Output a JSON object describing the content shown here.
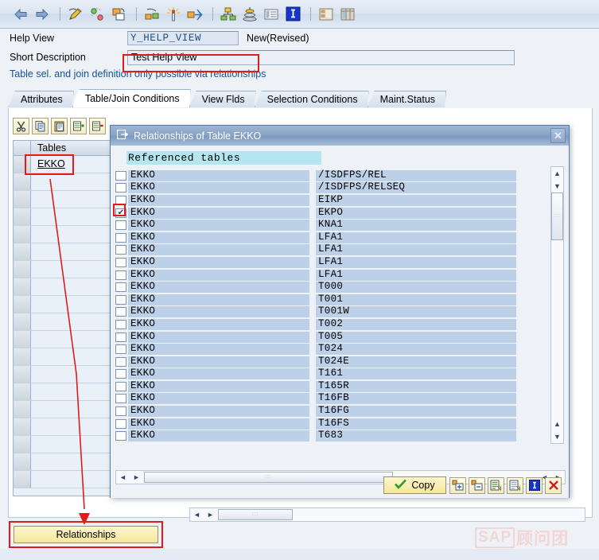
{
  "toolbar": {
    "icons": [
      {
        "name": "back-arrow-icon",
        "label": "Back"
      },
      {
        "name": "forward-arrow-icon",
        "label": "Forward"
      },
      {
        "name": "display-change-pencil-icon",
        "label": "Display/Change"
      },
      {
        "name": "activate-refresh-icon",
        "label": "Activate"
      },
      {
        "name": "copy-object-icon",
        "label": "Copy"
      },
      {
        "name": "where-used-list-icon",
        "label": "Where-Used List"
      },
      {
        "name": "new-entries-star-icon",
        "label": "New Entries"
      },
      {
        "name": "expand-navigate-icon",
        "label": "Navigate"
      },
      {
        "name": "hierarchy-icon",
        "label": "Hierarchy"
      },
      {
        "name": "stack-layers-icon",
        "label": "Layers"
      },
      {
        "name": "list-view-icon",
        "label": "List"
      },
      {
        "name": "information-icon",
        "label": "Information"
      },
      {
        "name": "table-maintenance-icon",
        "label": "Table Maintenance"
      },
      {
        "name": "grid-table-icon",
        "label": "Grid"
      }
    ]
  },
  "header": {
    "help_view_label": "Help View",
    "help_view_value": "Y_HELP_VIEW",
    "status": "New(Revised)",
    "short_description_label": "Short Description",
    "short_description_value": "Test Help View",
    "warning_message": "Table sel. and join definition only possible via relationships"
  },
  "tabs": [
    {
      "label": "Attributes",
      "active": false
    },
    {
      "label": "Table/Join Conditions",
      "active": true
    },
    {
      "label": "View Flds",
      "active": false
    },
    {
      "label": "Selection Conditions",
      "active": false
    },
    {
      "label": "Maint.Status",
      "active": false
    }
  ],
  "grid_toolbar": {
    "buttons": [
      {
        "name": "cut-button",
        "label": "Cut"
      },
      {
        "name": "copy-button",
        "label": "Copy"
      },
      {
        "name": "paste-button",
        "label": "Paste"
      },
      {
        "name": "insert-row-button",
        "label": "Insert Row"
      },
      {
        "name": "delete-row-button",
        "label": "Delete Row"
      }
    ]
  },
  "tables_grid": {
    "column_header": "Tables",
    "rows": [
      {
        "value": "EKKO",
        "highlighted": true
      },
      {
        "value": "",
        "highlighted": false
      },
      {
        "value": "",
        "highlighted": false
      },
      {
        "value": "",
        "highlighted": false
      },
      {
        "value": "",
        "highlighted": false
      },
      {
        "value": "",
        "highlighted": false
      },
      {
        "value": "",
        "highlighted": false
      },
      {
        "value": "",
        "highlighted": false
      },
      {
        "value": "",
        "highlighted": false
      },
      {
        "value": "",
        "highlighted": false
      },
      {
        "value": "",
        "highlighted": false
      },
      {
        "value": "",
        "highlighted": false
      },
      {
        "value": "",
        "highlighted": false
      },
      {
        "value": "",
        "highlighted": false
      },
      {
        "value": "",
        "highlighted": false
      },
      {
        "value": "",
        "highlighted": false
      },
      {
        "value": "",
        "highlighted": false
      },
      {
        "value": "",
        "highlighted": false
      },
      {
        "value": "",
        "highlighted": false
      }
    ]
  },
  "relationships_button": {
    "label": "Relationships"
  },
  "dialog": {
    "title": "Relationships of Table EKKO",
    "title_icon": "dialog-window-icon",
    "close_label": "✕",
    "list_header": "Referenced tables",
    "rows": [
      {
        "base_table": "EKKO",
        "referenced_table": "/ISDFPS/REL",
        "checked": false
      },
      {
        "base_table": "EKKO",
        "referenced_table": "/ISDFPS/RELSEQ",
        "checked": false
      },
      {
        "base_table": "EKKO",
        "referenced_table": "EIKP",
        "checked": false
      },
      {
        "base_table": "EKKO",
        "referenced_table": "EKPO",
        "checked": true
      },
      {
        "base_table": "EKKO",
        "referenced_table": "KNA1",
        "checked": false
      },
      {
        "base_table": "EKKO",
        "referenced_table": "LFA1",
        "checked": false
      },
      {
        "base_table": "EKKO",
        "referenced_table": "LFA1",
        "checked": false
      },
      {
        "base_table": "EKKO",
        "referenced_table": "LFA1",
        "checked": false
      },
      {
        "base_table": "EKKO",
        "referenced_table": "LFA1",
        "checked": false
      },
      {
        "base_table": "EKKO",
        "referenced_table": "T000",
        "checked": false
      },
      {
        "base_table": "EKKO",
        "referenced_table": "T001",
        "checked": false
      },
      {
        "base_table": "EKKO",
        "referenced_table": "T001W",
        "checked": false
      },
      {
        "base_table": "EKKO",
        "referenced_table": "T002",
        "checked": false
      },
      {
        "base_table": "EKKO",
        "referenced_table": "T005",
        "checked": false
      },
      {
        "base_table": "EKKO",
        "referenced_table": "T024",
        "checked": false
      },
      {
        "base_table": "EKKO",
        "referenced_table": "T024E",
        "checked": false
      },
      {
        "base_table": "EKKO",
        "referenced_table": "T161",
        "checked": false
      },
      {
        "base_table": "EKKO",
        "referenced_table": "T165R",
        "checked": false
      },
      {
        "base_table": "EKKO",
        "referenced_table": "T16FB",
        "checked": false
      },
      {
        "base_table": "EKKO",
        "referenced_table": "T16FG",
        "checked": false
      },
      {
        "base_table": "EKKO",
        "referenced_table": "T16FS",
        "checked": false
      },
      {
        "base_table": "EKKO",
        "referenced_table": "T683",
        "checked": false
      }
    ],
    "buttons": {
      "copy_label": "Copy",
      "copy_icon": "green-check-icon",
      "icon_buttons": [
        {
          "name": "expand-all-button",
          "label": "Expand"
        },
        {
          "name": "collapse-all-button",
          "label": "Collapse"
        },
        {
          "name": "select-all-button",
          "label": "Select All"
        },
        {
          "name": "deselect-all-button",
          "label": "Deselect All"
        },
        {
          "name": "info-button",
          "label": "Information"
        },
        {
          "name": "cancel-button",
          "label": "Cancel"
        }
      ]
    }
  },
  "watermark": {
    "brand": "SAP",
    "text": "顾问团"
  },
  "colors": {
    "accent_blue": "#1650a0",
    "row_blue": "#bcd0e8",
    "header_cyan": "#b4e6f0",
    "button_yellow": "#f5e79a",
    "annotation_red": "#e01b1b"
  }
}
